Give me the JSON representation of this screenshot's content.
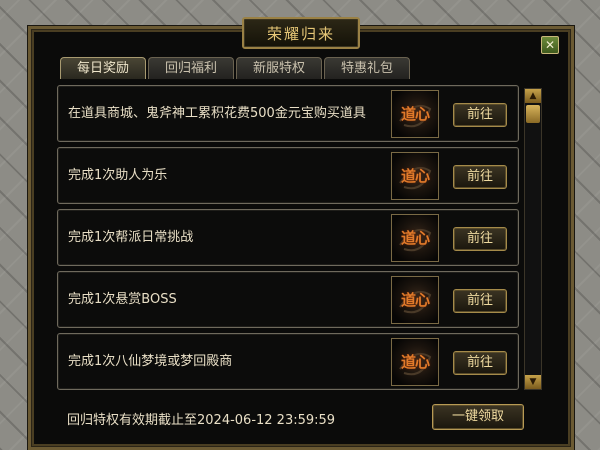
{
  "window": {
    "title": "荣耀归来",
    "close_label": "✕"
  },
  "tabs": [
    {
      "label": "每日奖励",
      "active": true
    },
    {
      "label": "回归福利",
      "active": false
    },
    {
      "label": "新服特权",
      "active": false
    },
    {
      "label": "特惠礼包",
      "active": false
    }
  ],
  "tasks": [
    {
      "text": "在道具商城、鬼斧神工累积花费500金元宝购买道具",
      "reward_label": "道心",
      "button_label": "前往"
    },
    {
      "text": "完成1次助人为乐",
      "reward_label": "道心",
      "button_label": "前往"
    },
    {
      "text": "完成1次帮派日常挑战",
      "reward_label": "道心",
      "button_label": "前往"
    },
    {
      "text": "完成1次悬赏BOSS",
      "reward_label": "道心",
      "button_label": "前往"
    },
    {
      "text": "完成1次八仙梦境或梦回殿商",
      "reward_label": "道心",
      "button_label": "前往"
    }
  ],
  "scrollbar": {
    "up_icon": "▲",
    "down_icon": "▼"
  },
  "footer": {
    "expiry_text": "回归特权有效期截止至2024-06-12 23:59:59",
    "claim_all_label": "一键领取"
  },
  "colors": {
    "accent_gold": "#e6c777",
    "reward_text": "#e07a2a",
    "panel_bg": "#0b0b0a"
  }
}
